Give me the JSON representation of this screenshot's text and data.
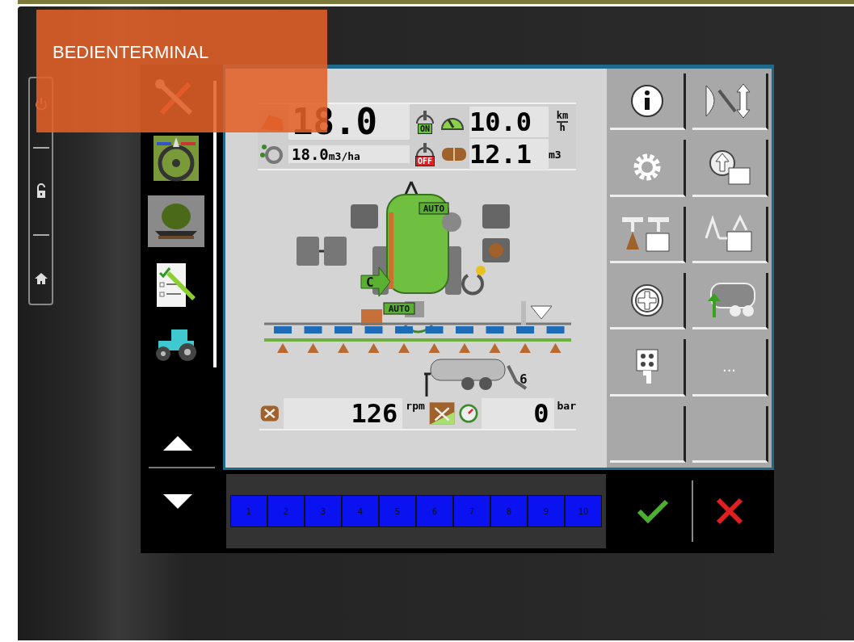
{
  "overlay_label": "BEDIENTERMINAL",
  "nav_items": [
    {
      "kind": "tools",
      "selected": false
    },
    {
      "kind": "steering",
      "selected": false
    },
    {
      "kind": "sprayer",
      "selected": true
    },
    {
      "kind": "checklist",
      "selected": false
    },
    {
      "kind": "tractor",
      "selected": false
    }
  ],
  "readouts": {
    "rate_actual": "18.0",
    "rate_setpoint": "18.0",
    "rate_unit": "m3/ha",
    "switch_on": "ON",
    "switch_off": "OFF",
    "speed": "10.0",
    "speed_unit_top": "km",
    "speed_unit_bottom": "h",
    "volume": "12.1",
    "volume_unit": "m3"
  },
  "diagram": {
    "tank_auto": "AUTO",
    "pump_auto": "AUTO",
    "direction_label": "C",
    "hitch_label": "6"
  },
  "bottom_readouts": {
    "rpm": "126",
    "rpm_unit": "rpm",
    "pressure": "0",
    "pressure_unit": "bar"
  },
  "softkeys": [
    {
      "kind": "info"
    },
    {
      "kind": "boom-fold"
    },
    {
      "kind": "settings"
    },
    {
      "kind": "tank-fill"
    },
    {
      "kind": "nozzle-section"
    },
    {
      "kind": "boom-section"
    },
    {
      "kind": "add"
    },
    {
      "kind": "tanker"
    },
    {
      "kind": "keypad"
    },
    {
      "kind": "more",
      "label": "..."
    },
    {
      "kind": "empty"
    },
    {
      "kind": "empty"
    }
  ],
  "sections": [
    {
      "label": "1",
      "on": true
    },
    {
      "label": "2",
      "on": true
    },
    {
      "label": "3",
      "on": true
    },
    {
      "label": "4",
      "on": true
    },
    {
      "label": "5",
      "on": true
    },
    {
      "label": "6",
      "on": true
    },
    {
      "label": "7",
      "on": true
    },
    {
      "label": "8",
      "on": true
    },
    {
      "label": "9",
      "on": true
    },
    {
      "label": "10",
      "on": true
    }
  ]
}
